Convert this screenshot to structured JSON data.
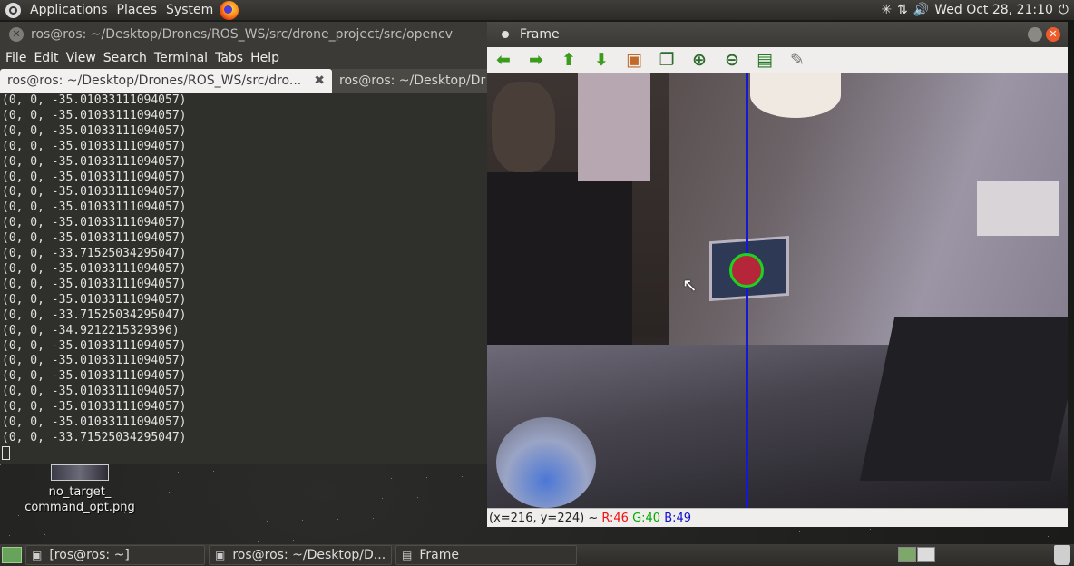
{
  "top_panel": {
    "menus": [
      "Applications",
      "Places",
      "System"
    ],
    "clock": "Wed Oct 28, 21:10"
  },
  "terminal": {
    "title": "ros@ros: ~/Desktop/Drones/ROS_WS/src/drone_project/src/opencv",
    "menu": [
      "File",
      "Edit",
      "View",
      "Search",
      "Terminal",
      "Tabs",
      "Help"
    ],
    "tabs": [
      {
        "label": "ros@ros: ~/Desktop/Drones/ROS_WS/src/dro..."
      },
      {
        "label": "ros@ros: ~/Desktop/Dr"
      }
    ],
    "lines": [
      "(0, 0, -35.01033111094057)",
      "(0, 0, -35.01033111094057)",
      "(0, 0, -35.01033111094057)",
      "(0, 0, -35.01033111094057)",
      "(0, 0, -35.01033111094057)",
      "(0, 0, -35.01033111094057)",
      "(0, 0, -35.01033111094057)",
      "(0, 0, -35.01033111094057)",
      "(0, 0, -35.01033111094057)",
      "(0, 0, -35.01033111094057)",
      "(0, 0, -33.71525034295047)",
      "(0, 0, -35.01033111094057)",
      "(0, 0, -35.01033111094057)",
      "(0, 0, -35.01033111094057)",
      "(0, 0, -33.71525034295047)",
      "(0, 0, -34.9212215329396)",
      "(0, 0, -35.01033111094057)",
      "(0, 0, -35.01033111094057)",
      "(0, 0, -35.01033111094057)",
      "(0, 0, -35.01033111094057)",
      "(0, 0, -35.01033111094057)",
      "(0, 0, -35.01033111094057)",
      "(0, 0, -33.71525034295047)"
    ]
  },
  "desktop_file": {
    "label_line1": "no_target_",
    "label_line2": "command_opt.png"
  },
  "frame_window": {
    "title": "Frame",
    "status": {
      "coords": "(x=216, y=224) ~",
      "r": "R:46",
      "g": "G:40",
      "b": "B:49"
    },
    "colors": {
      "line": "#1418d6",
      "circle_border": "#1fd222",
      "circle_fill": "#b5263a"
    }
  },
  "taskbar": {
    "items": [
      {
        "label": "[ros@ros: ~]"
      },
      {
        "label": "ros@ros: ~/Desktop/D..."
      },
      {
        "label": "Frame"
      }
    ]
  }
}
